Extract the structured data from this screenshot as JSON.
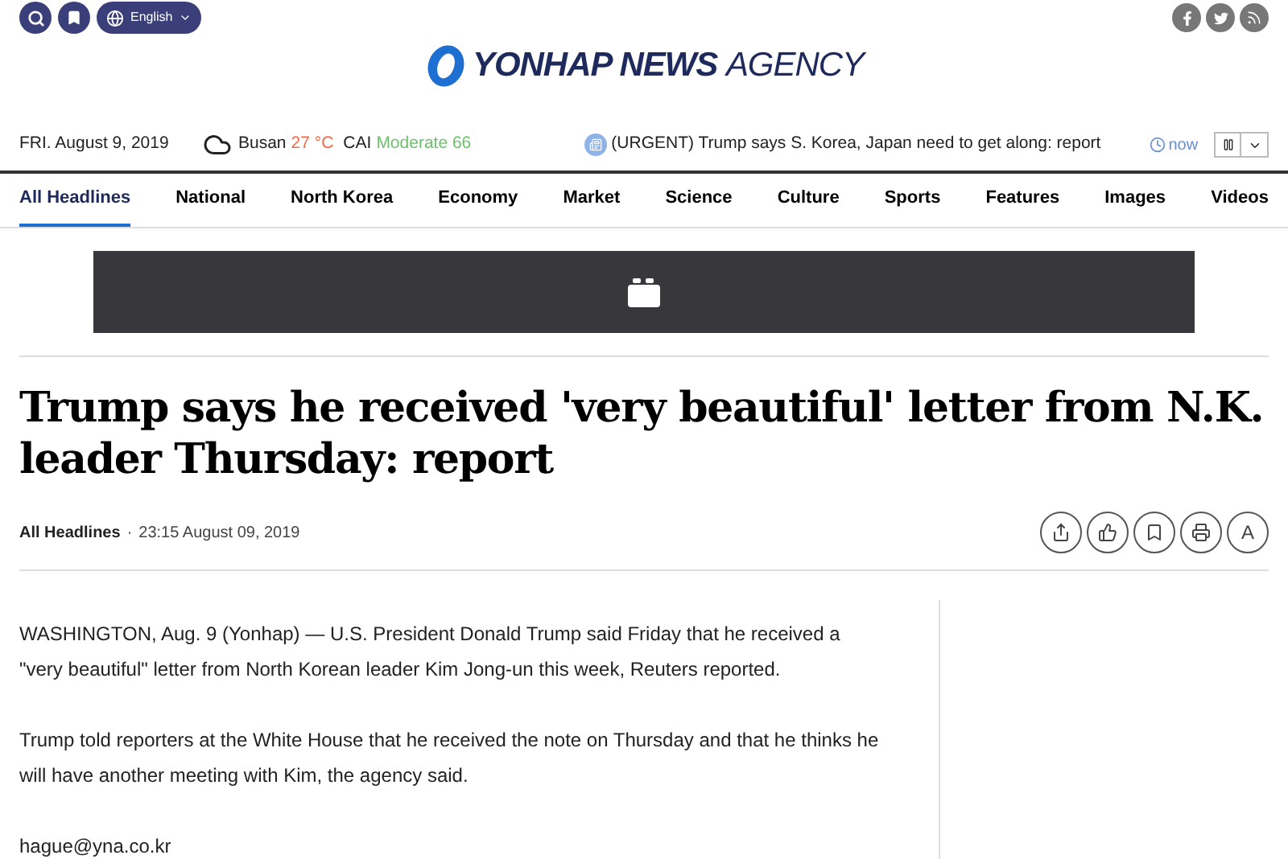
{
  "top_bar": {
    "language": "English"
  },
  "logo": {
    "bold": "YONHAP NEWS",
    "light": "AGENCY"
  },
  "info_bar": {
    "date": "FRI. August 9, 2019",
    "city": "Busan",
    "temperature": "27 °C",
    "cai_label": "CAI",
    "cai_value": "Moderate 66",
    "ticker": "(URGENT) Trump says S. Korea, Japan need to get along: report",
    "ticker_time": "now"
  },
  "nav": [
    {
      "label": "All Headlines",
      "selected": true
    },
    {
      "label": "National",
      "selected": false
    },
    {
      "label": "North Korea",
      "selected": false
    },
    {
      "label": "Economy",
      "selected": false
    },
    {
      "label": "Market",
      "selected": false
    },
    {
      "label": "Science",
      "selected": false
    },
    {
      "label": "Culture",
      "selected": false
    },
    {
      "label": "Sports",
      "selected": false
    },
    {
      "label": "Features",
      "selected": false
    },
    {
      "label": "Images",
      "selected": false
    },
    {
      "label": "Videos",
      "selected": false
    }
  ],
  "article": {
    "headline": "Trump says he received 'very beautiful' letter from N.K. leader Thursday: report",
    "section": "All Headlines",
    "separator": "·",
    "timestamp": "23:15 August 09, 2019",
    "font_button": "A",
    "paragraphs": [
      "WASHINGTON, Aug. 9 (Yonhap) — U.S. President Donald Trump said Friday that he received a \"very beautiful\" letter from North Korean leader Kim Jong-un this week, Reuters reported.",
      "Trump told reporters at the White House that he received the note on Thursday and that he thinks he will have another meeting with Kim, the agency said.",
      "hague@yna.co.kr"
    ]
  }
}
